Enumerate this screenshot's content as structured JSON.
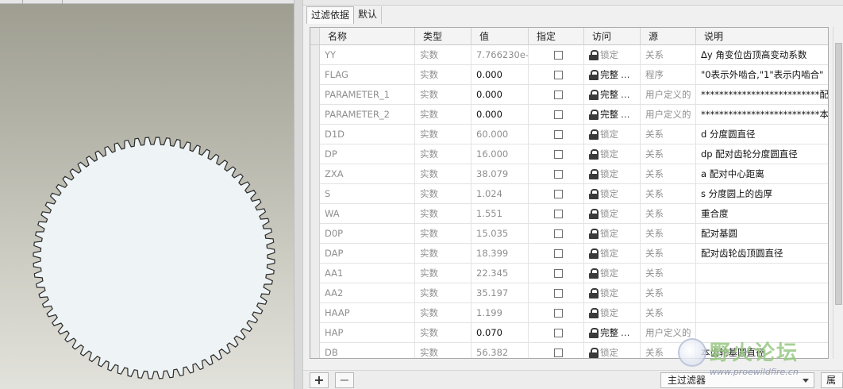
{
  "filter_bar": {
    "label": "过滤依据",
    "default_tab": "默认"
  },
  "table": {
    "headers": [
      "名称",
      "类型",
      "值",
      "指定",
      "访问",
      "源",
      "说明"
    ],
    "rows": [
      {
        "name": "YY",
        "type": "实数",
        "value": "7.766230e-",
        "editable": false,
        "access": "锁定",
        "access_full": false,
        "source": "关系",
        "desc": "Δy  角变位齿顶高变动系数"
      },
      {
        "name": "FLAG",
        "type": "实数",
        "value": "0.000",
        "editable": true,
        "access": "完整",
        "access_full": true,
        "source": "程序",
        "desc": "\"0表示外啮合,\"1\"表示内啮合\""
      },
      {
        "name": "PARAMETER_1",
        "type": "实数",
        "value": "0.000",
        "editable": true,
        "access": "完整",
        "access_full": true,
        "source": "用户定义的",
        "desc": "**************************配对..."
      },
      {
        "name": "PARAMETER_2",
        "type": "实数",
        "value": "0.000",
        "editable": true,
        "access": "完整",
        "access_full": true,
        "source": "用户定义的",
        "desc": "**************************本齿..."
      },
      {
        "name": "D1D",
        "type": "实数",
        "value": "60.000",
        "editable": false,
        "access": "锁定",
        "access_full": false,
        "source": "关系",
        "desc": "d  分度圆直径"
      },
      {
        "name": "DP",
        "type": "实数",
        "value": "16.000",
        "editable": false,
        "access": "锁定",
        "access_full": false,
        "source": "关系",
        "desc": "dp  配对齿轮分度圆直径"
      },
      {
        "name": "ZXA",
        "type": "实数",
        "value": "38.079",
        "editable": false,
        "access": "锁定",
        "access_full": false,
        "source": "关系",
        "desc": "a   配对中心距离"
      },
      {
        "name": "S",
        "type": "实数",
        "value": "1.024",
        "editable": false,
        "access": "锁定",
        "access_full": false,
        "source": "关系",
        "desc": "s  分度圆上的齿厚"
      },
      {
        "name": "WA",
        "type": "实数",
        "value": "1.551",
        "editable": false,
        "access": "锁定",
        "access_full": false,
        "source": "关系",
        "desc": "重合度"
      },
      {
        "name": "D0P",
        "type": "实数",
        "value": "15.035",
        "editable": false,
        "access": "锁定",
        "access_full": false,
        "source": "关系",
        "desc": "配对基圆"
      },
      {
        "name": "DAP",
        "type": "实数",
        "value": "18.399",
        "editable": false,
        "access": "锁定",
        "access_full": false,
        "source": "关系",
        "desc": "配对齿轮齿顶圆直径"
      },
      {
        "name": "AA1",
        "type": "实数",
        "value": "22.345",
        "editable": false,
        "access": "锁定",
        "access_full": false,
        "source": "关系",
        "desc": ""
      },
      {
        "name": "AA2",
        "type": "实数",
        "value": "35.197",
        "editable": false,
        "access": "锁定",
        "access_full": false,
        "source": "关系",
        "desc": ""
      },
      {
        "name": "HAAP",
        "type": "实数",
        "value": "1.199",
        "editable": false,
        "access": "锁定",
        "access_full": false,
        "source": "关系",
        "desc": ""
      },
      {
        "name": "HAP",
        "type": "实数",
        "value": "0.070",
        "editable": true,
        "access": "完整",
        "access_full": true,
        "source": "用户定义的",
        "desc": ""
      },
      {
        "name": "DB",
        "type": "实数",
        "value": "56.382",
        "editable": false,
        "access": "锁定",
        "access_full": false,
        "source": "关系",
        "desc": "本齿轮基圆直径"
      }
    ]
  },
  "toolbar": {
    "add": "+",
    "remove": "−",
    "main_filter": "主过滤器",
    "attributes": "属"
  },
  "watermark": {
    "title": "野火论坛",
    "url": "www.proewildfire.cn"
  },
  "gear": {
    "teeth": 72,
    "fill": "#eef4f6",
    "stroke": "#2a2a2a"
  }
}
